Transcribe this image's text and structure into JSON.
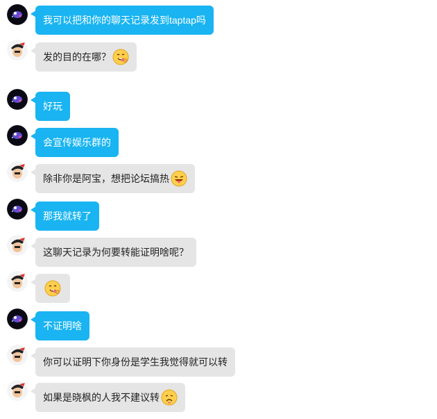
{
  "chat": {
    "messages": [
      {
        "sender": "self",
        "text": "我可以把和你的聊天记录发到taptap吗",
        "emoji": ""
      },
      {
        "sender": "other",
        "text": "发的目的在哪？",
        "emoji": "yum-emoji-icon"
      },
      {
        "sender": "self",
        "text": "好玩",
        "emoji": ""
      },
      {
        "sender": "self",
        "text": "会宣传娱乐群的",
        "emoji": ""
      },
      {
        "sender": "other",
        "text": "除非你是阿宝，想把论坛搞热",
        "emoji": "tongue-emoji-icon"
      },
      {
        "sender": "self",
        "text": "那我就转了",
        "emoji": ""
      },
      {
        "sender": "other",
        "text": "这聊天记录为何要转能证明啥呢？",
        "emoji": ""
      },
      {
        "sender": "other",
        "text": "",
        "emoji": "yum-emoji-icon"
      },
      {
        "sender": "self",
        "text": "不证明啥",
        "emoji": ""
      },
      {
        "sender": "other",
        "text": "你可以证明下你身份是学生我觉得就可以转",
        "emoji": ""
      },
      {
        "sender": "other",
        "text": "如果是晓枫的人我不建议转",
        "emoji": "sad-emoji-icon"
      }
    ]
  },
  "colors": {
    "self_bubble": "#19b4f1",
    "other_bubble": "#e5e5e5"
  },
  "avatars": {
    "self": "galaxy-avatar",
    "other": "cartoon-avatar"
  }
}
